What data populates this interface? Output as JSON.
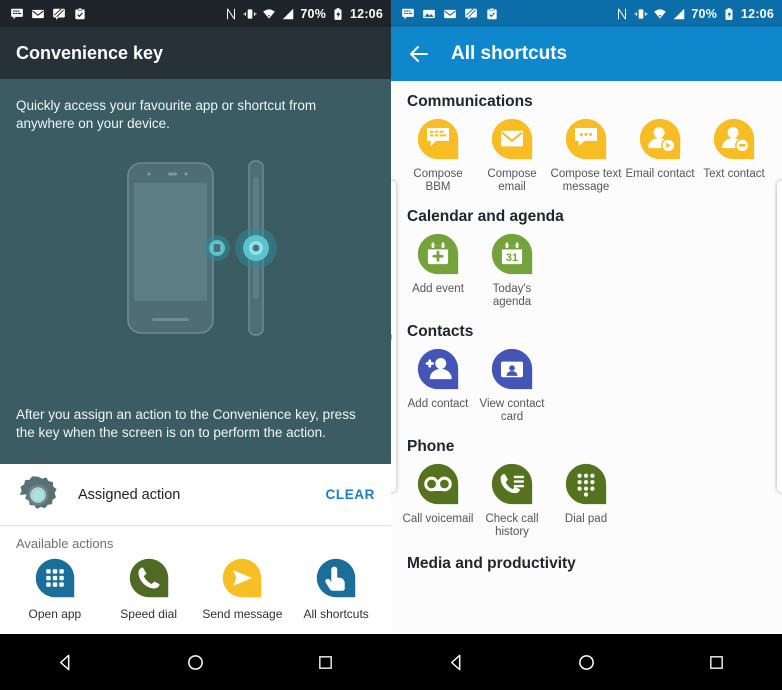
{
  "left_screen": {
    "status_bar": {
      "left_icons": [
        "bbm-icon",
        "mail-icon",
        "hangouts-icon",
        "tasks-icon"
      ],
      "right_icons": [
        "nfc-icon",
        "vibrate-icon",
        "wifi-icon",
        "signal-icon"
      ],
      "battery_percent": "70%",
      "battery_icon": "battery-charging-icon",
      "time": "12:06"
    },
    "title": "Convenience key",
    "hero_top_text": "Quickly access your favourite app or shortcut from anywhere on your device.",
    "hero_bottom_text": "After you assign an action to the Convenience key, press the key when the screen is on to perform the action.",
    "assigned_row": {
      "icon": "gear-icon",
      "label": "Assigned action",
      "clear_label": "CLEAR"
    },
    "available_actions_title": "Available actions",
    "available_actions": [
      {
        "label": "Open app",
        "icon": "apps-grid-icon",
        "color": "#1a6e99"
      },
      {
        "label": "Speed dial",
        "icon": "phone-icon",
        "color": "#4f6a23"
      },
      {
        "label": "Send message",
        "icon": "send-icon",
        "color": "#f8bf24"
      },
      {
        "label": "All shortcuts",
        "icon": "tap-finger-icon",
        "color": "#1a6e99"
      }
    ],
    "nav_buttons": [
      "back-button",
      "home-button",
      "recents-button"
    ]
  },
  "right_screen": {
    "status_bar": {
      "left_icons": [
        "bbm-icon",
        "image-icon",
        "mail-icon",
        "hangouts-icon",
        "tasks-icon"
      ],
      "right_icons": [
        "nfc-icon",
        "vibrate-icon",
        "wifi-icon",
        "signal-icon"
      ],
      "battery_percent": "70%",
      "battery_icon": "battery-charging-icon",
      "time": "12:06"
    },
    "back_icon": "arrow-left-icon",
    "title": "All shortcuts",
    "accent_color": "#0e87cc",
    "sections": [
      {
        "title": "Communications",
        "color": "#f9bd24",
        "items": [
          {
            "label": "Compose BBM",
            "icon": "bbm-chat-icon"
          },
          {
            "label": "Compose\nemail",
            "icon": "envelope-icon"
          },
          {
            "label": "Compose text\nmessage",
            "icon": "chat-bubble-icon"
          },
          {
            "label": "Email contact",
            "icon": "contact-send-icon"
          },
          {
            "label": "Text contact",
            "icon": "contact-message-icon"
          }
        ]
      },
      {
        "title": "Calendar and agenda",
        "color": "#74a33c",
        "items": [
          {
            "label": "Add event",
            "icon": "calendar-plus-icon"
          },
          {
            "label": "Today's\nagenda",
            "icon": "calendar-31-icon"
          }
        ]
      },
      {
        "title": "Contacts",
        "color": "#4356b8",
        "items": [
          {
            "label": "Add contact",
            "icon": "person-add-icon"
          },
          {
            "label": "View contact\ncard",
            "icon": "contact-card-icon"
          }
        ]
      },
      {
        "title": "Phone",
        "color": "#55731f",
        "items": [
          {
            "label": "Call voicemail",
            "icon": "voicemail-icon"
          },
          {
            "label": "Check call\nhistory",
            "icon": "call-history-icon"
          },
          {
            "label": "Dial pad",
            "icon": "dialpad-icon"
          }
        ]
      },
      {
        "title": "Media and productivity",
        "color": "#20262b",
        "items": []
      }
    ],
    "nav_buttons": [
      "back-button",
      "home-button",
      "recents-button"
    ]
  }
}
